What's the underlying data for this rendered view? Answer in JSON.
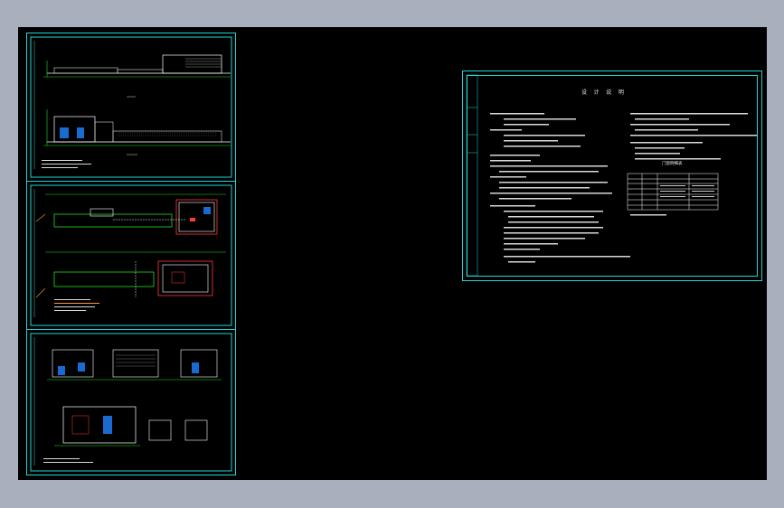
{
  "viewer": {
    "background_color": "#a9b0bd",
    "canvas_color": "#000000",
    "frame_color": "#1fd6d6"
  },
  "notes_sheet": {
    "title": "设 计 说 明",
    "table_heading": "门窗明细表"
  }
}
